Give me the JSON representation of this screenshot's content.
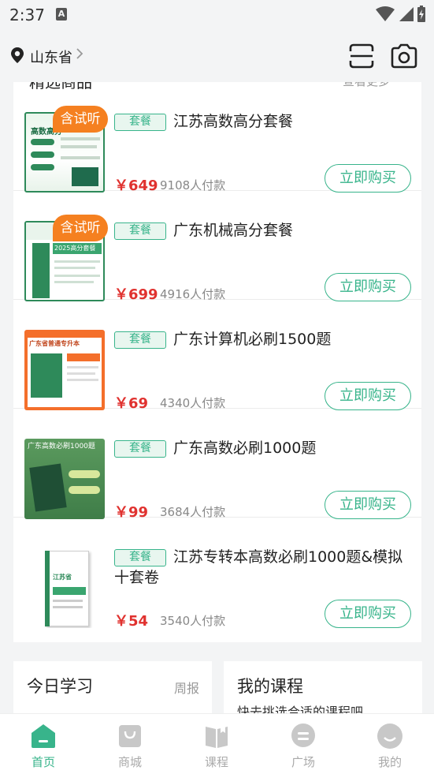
{
  "status_bar": {
    "time": "2:37",
    "notification_letter": "A"
  },
  "header": {
    "location": "山东省"
  },
  "section": {
    "title_peek": "精选商品",
    "more_peek": "查看更多"
  },
  "products": [
    {
      "badge": "含试听",
      "tag": "套餐",
      "title": "江苏高数高分套餐",
      "price": "￥649",
      "sold": "9108人付款",
      "buy": "立即购买",
      "thumb_text": "高数高分"
    },
    {
      "badge": "含试听",
      "tag": "套餐",
      "title": "广东机械高分套餐",
      "price": "￥699",
      "sold": "4916人付款",
      "buy": "立即购买",
      "thumb_text": "2025高分套餐"
    },
    {
      "badge": "",
      "tag": "套餐",
      "title": "广东计算机必刷1500题",
      "price": "￥69",
      "sold": "4340人付款",
      "buy": "立即购买",
      "thumb_text": "广东省普通专升本"
    },
    {
      "badge": "",
      "tag": "套餐",
      "title": "广东高数必刷1000题",
      "price": "￥99",
      "sold": "3684人付款",
      "buy": "立即购买",
      "thumb_text": "广东高数必刷1000题"
    },
    {
      "badge": "",
      "tag": "套餐",
      "title": "江苏专转本高数必刷1000题&模拟十套卷",
      "price": "￥54",
      "sold": "3540人付款",
      "buy": "立即购买",
      "thumb_text": "江苏省"
    }
  ],
  "today_learning": {
    "title": "今日学习",
    "weekly": "周报"
  },
  "my_courses": {
    "title": "我的课程",
    "subtitle": "快去挑选合适的课程吧"
  },
  "tabs": [
    {
      "label": "首页",
      "icon": "home-icon",
      "active": true
    },
    {
      "label": "商城",
      "icon": "shop-icon",
      "active": false
    },
    {
      "label": "课程",
      "icon": "course-icon",
      "active": false
    },
    {
      "label": "广场",
      "icon": "square-icon",
      "active": false
    },
    {
      "label": "我的",
      "icon": "profile-icon",
      "active": false
    }
  ],
  "colors": {
    "accent": "#38b48b",
    "price": "#e0322f",
    "badge": "#f58020",
    "background": "#f3f4f5"
  }
}
